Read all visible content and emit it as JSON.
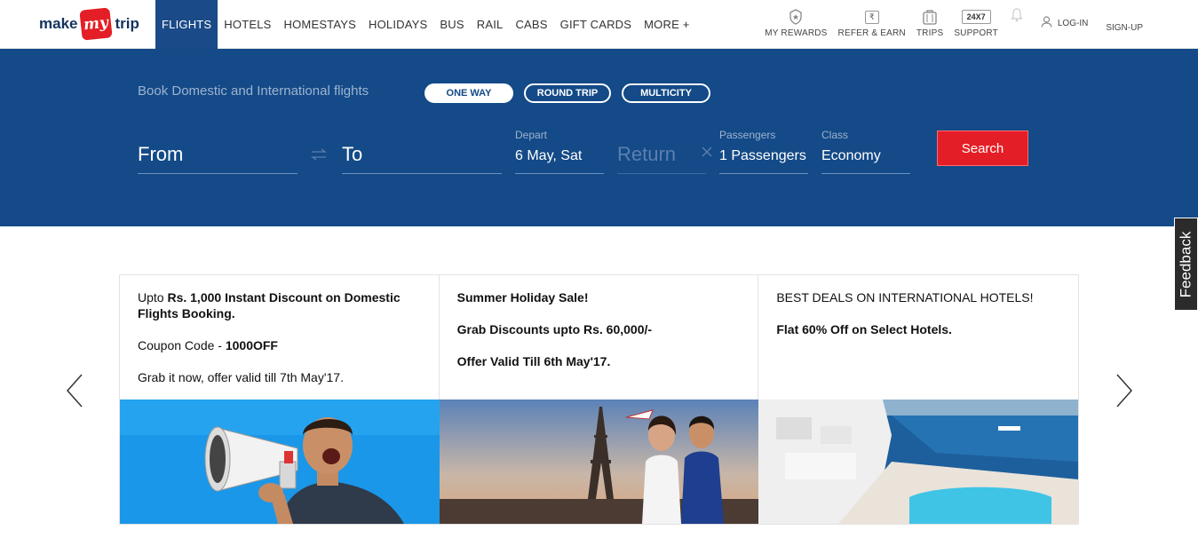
{
  "brand": {
    "part1": "make",
    "badge": "my",
    "part2": "trip",
    "accent": "#e41e26",
    "navy": "#134a87"
  },
  "nav": {
    "items": [
      {
        "label": "FLIGHTS",
        "active": true
      },
      {
        "label": "HOTELS"
      },
      {
        "label": "HOMESTAYS"
      },
      {
        "label": "HOLIDAYS"
      },
      {
        "label": "BUS"
      },
      {
        "label": "RAIL"
      },
      {
        "label": "CABS"
      },
      {
        "label": "GIFT CARDS"
      },
      {
        "label": "MORE +"
      }
    ]
  },
  "utils": {
    "rewards": {
      "label": "MY REWARDS",
      "icon": "badge-icon"
    },
    "refer": {
      "label": "REFER & EARN",
      "icon": "rupee-note-icon",
      "glyph": "₹"
    },
    "trips": {
      "label": "TRIPS",
      "icon": "suitcase-icon"
    },
    "support": {
      "label": "SUPPORT",
      "box": "24X7"
    },
    "notifications": {
      "icon": "bell-icon"
    },
    "login": {
      "label": "LOG-IN",
      "icon": "user-icon"
    },
    "signup": {
      "label": "SIGN-UP"
    }
  },
  "search": {
    "tagline": "Book Domestic and International flights",
    "trip_types": [
      "ONE WAY",
      "ROUND TRIP",
      "MULTICITY"
    ],
    "selected_trip_type": "ONE WAY",
    "from_placeholder": "From",
    "to_placeholder": "To",
    "depart_label": "Depart",
    "depart_value": "6 May, Sat",
    "return_placeholder": "Return",
    "passengers_label": "Passengers",
    "passengers_value": "1 Passengers",
    "class_label": "Class",
    "class_value": "Economy",
    "search_label": "Search"
  },
  "feedback": {
    "label": "Feedback"
  },
  "offers": [
    {
      "line1_prefix": "Upto ",
      "line1_bold": "Rs. 1,000 Instant Discount on Domestic Flights Booking.",
      "coupon_prefix": "Coupon Code - ",
      "coupon_code": "1000OFF",
      "validity": "Grab it now, offer valid till 7th May'17.",
      "image": "man-with-megaphone"
    },
    {
      "title": "Summer Holiday Sale!",
      "discount": "Grab Discounts upto Rs. 60,000/-",
      "validity": "Offer Valid Till 6th May'17.",
      "image": "couple-at-eiffel-tower"
    },
    {
      "title": "BEST DEALS ON INTERNATIONAL HOTELS!",
      "deal": "Flat 60% Off on Select Hotels.",
      "image": "santorini-pool-view"
    }
  ]
}
